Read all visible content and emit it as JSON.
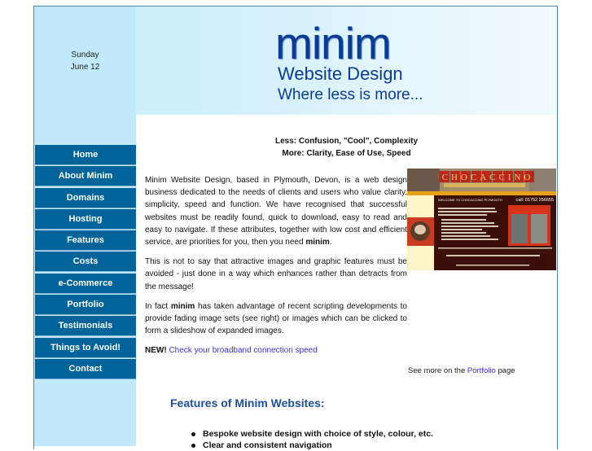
{
  "date": {
    "weekday": "Sunday",
    "day": "June 12"
  },
  "logo": {
    "name": "minim",
    "subtitle": "Website Design",
    "tagline": "Where less is more..."
  },
  "nav": {
    "items": [
      {
        "label": "Home"
      },
      {
        "label": "About Minim"
      },
      {
        "label": "Domains"
      },
      {
        "label": "Hosting"
      },
      {
        "label": "Features"
      },
      {
        "label": "Costs"
      },
      {
        "label": "e-Commerce"
      },
      {
        "label": "Portfolio"
      },
      {
        "label": "Testimonials"
      },
      {
        "label": "Things to Avoid!"
      },
      {
        "label": "Contact"
      }
    ]
  },
  "tagline": {
    "less": "Less: Confusion, \"Cool\", Complexity",
    "more": "More: Clarity, Ease of Use, Speed"
  },
  "intro": {
    "p1_before": "Minim Website Design, based in Plymouth, Devon, is a web design business dedicated to the needs of clients and users who value clarity, simplicity, speed and function. We have recognised that successful websites must be readily found, quick to download, easy to read and easy to navigate. If these attributes, together with low cost and efficient service, are priorities for you, then you need ",
    "p1_bold": "minim",
    "p1_after": ".",
    "p2": "This is not to say that attractive images and graphic features must be avoided - just done in a way which enhances rather than detracts from the message!",
    "p3_before": "In fact ",
    "p3_bold": "minim",
    "p3_after": " has taken advantage of recent scripting developments to provide fading image sets (see right) or images which can be clicked to form a slideshow of expanded images.",
    "new_label": "NEW!",
    "new_link": "Check your broadband connection speed"
  },
  "showcase": {
    "site_name": "CHOCACCINO",
    "welcome": "WELCOME TO CHOCACCINO PLYMOUTH",
    "phone": "call: 01752 256655"
  },
  "see_more": {
    "before": "See more on the ",
    "link": "Portfolio",
    "after": " page"
  },
  "features": {
    "title": "Features of Minim Websites:",
    "items": [
      "Bespoke website design with choice of style, colour, etc.",
      "Clear and consistent navigation"
    ]
  }
}
